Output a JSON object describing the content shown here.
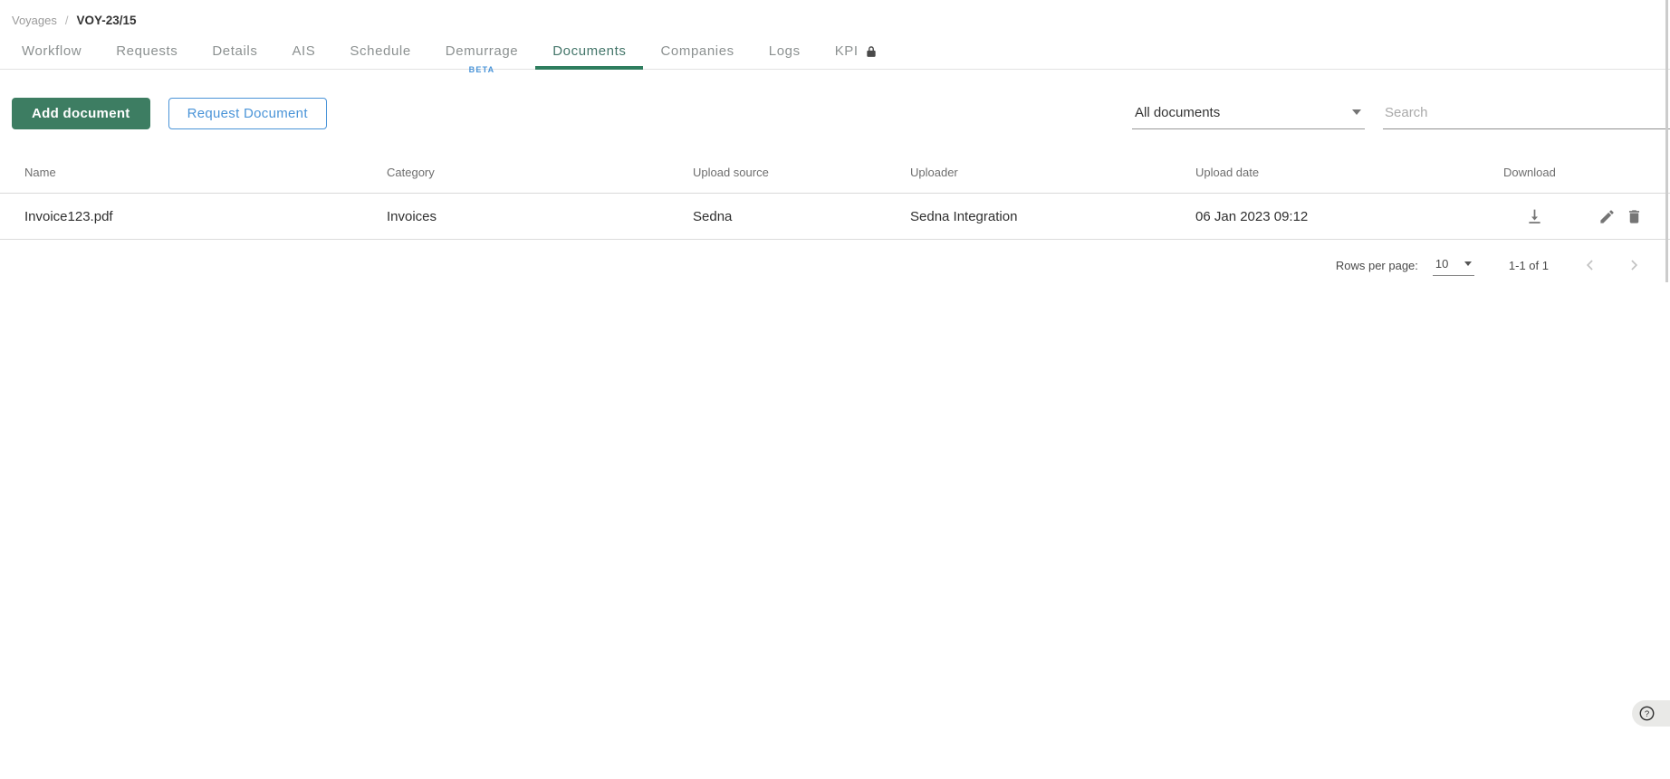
{
  "breadcrumb": {
    "parent": "Voyages",
    "separator": "/",
    "current": "VOY-23/15"
  },
  "tabs": {
    "items": [
      {
        "label": "Workflow"
      },
      {
        "label": "Requests"
      },
      {
        "label": "Details"
      },
      {
        "label": "AIS"
      },
      {
        "label": "Schedule"
      },
      {
        "label": "Demurrage",
        "badge": "BETA"
      },
      {
        "label": "Documents",
        "active": true
      },
      {
        "label": "Companies"
      },
      {
        "label": "Logs"
      },
      {
        "label": "KPI",
        "locked": true
      }
    ]
  },
  "toolbar": {
    "add_button": "Add document",
    "request_button": "Request Document",
    "filter_value": "All documents",
    "search_placeholder": "Search"
  },
  "table": {
    "columns": {
      "name": "Name",
      "category": "Category",
      "upload_source": "Upload source",
      "uploader": "Uploader",
      "upload_date": "Upload date",
      "download": "Download"
    },
    "rows": [
      {
        "name": "Invoice123.pdf",
        "category": "Invoices",
        "upload_source": "Sedna",
        "uploader": "Sedna Integration",
        "upload_date": "06 Jan 2023 09:12"
      }
    ]
  },
  "pagination": {
    "rows_per_page_label": "Rows per page:",
    "rows_per_page_value": "10",
    "range": "1-1 of 1"
  },
  "colors": {
    "primary_green": "#3d7d62",
    "active_tab_green": "#2e7d5e",
    "accent_blue": "#4a94d8",
    "icon_gray": "#757575"
  }
}
